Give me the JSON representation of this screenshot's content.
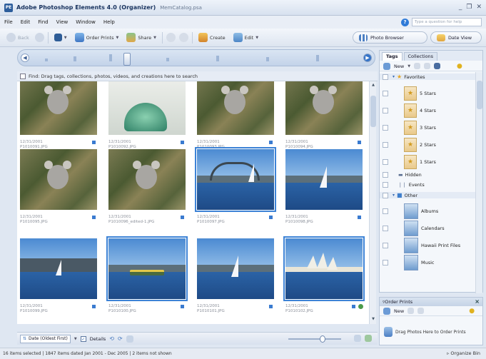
{
  "window": {
    "app_title": "Adobe Photoshop Elements 4.0 (Organizer)",
    "file_name": "MemCatalog.psa",
    "logo_text": "PE",
    "controls": [
      "_",
      "❐",
      "✕"
    ]
  },
  "menu": {
    "items": [
      "File",
      "Edit",
      "Find",
      "View",
      "Window",
      "Help"
    ],
    "help_placeholder": "Type a question for help"
  },
  "toolbar": {
    "back_label": "Back",
    "order_prints_label": "Order Prints",
    "share_label": "Share",
    "create_label": "Create",
    "edit_label": "Edit",
    "photo_browser_label": "Photo Browser",
    "date_view_label": "Date View"
  },
  "find_bar": {
    "text": "Find: Drag tags, collections, photos, videos, and creations here to search"
  },
  "photos": [
    {
      "date": "12/31/2001",
      "file": "P1010091.JPG",
      "scene": "koala",
      "selected": false
    },
    {
      "date": "12/31/2001",
      "file": "P1010092.JPG",
      "scene": "glass",
      "selected": false
    },
    {
      "date": "12/31/2001",
      "file": "P1010093.JPG",
      "scene": "koala",
      "selected": false
    },
    {
      "date": "12/31/2001",
      "file": "P1010094.JPG",
      "scene": "koala",
      "selected": false
    },
    {
      "date": "12/31/2001",
      "file": "P1010095.JPG",
      "scene": "koala",
      "selected": false
    },
    {
      "date": "12/31/2001",
      "file": "P1010096_edited-1.JPG",
      "scene": "koala",
      "selected": false
    },
    {
      "date": "12/31/2001",
      "file": "P1010097.JPG",
      "scene": "bridge",
      "selected": true
    },
    {
      "date": "12/31/2001",
      "file": "P1010098.JPG",
      "scene": "sail",
      "selected": false
    },
    {
      "date": "12/31/2001",
      "file": "P1010099.JPG",
      "scene": "sail-city",
      "selected": false
    },
    {
      "date": "12/31/2001",
      "file": "P1010100.JPG",
      "scene": "ferry",
      "selected": true
    },
    {
      "date": "12/31/2001",
      "file": "P1010101.JPG",
      "scene": "sail",
      "selected": false
    },
    {
      "date": "12/31/2001",
      "file": "P1010102.JPG",
      "scene": "opera",
      "selected": true
    }
  ],
  "bottom": {
    "sort_label": "Date (Oldest First)",
    "details_label": "Details"
  },
  "status": {
    "text": "16 items selected  |  1847 items dated Jan 2001 - Dec 2005  |  2 items not shown",
    "organize_bin": "Organize Bin"
  },
  "tags_panel": {
    "tabs": [
      "Tags",
      "Collections"
    ],
    "new_label": "New",
    "items": [
      {
        "label": "Favorites",
        "kind": "category"
      },
      {
        "label": "5 Stars",
        "kind": "star"
      },
      {
        "label": "4 Stars",
        "kind": "star"
      },
      {
        "label": "3 Stars",
        "kind": "star"
      },
      {
        "label": "2 Stars",
        "kind": "star"
      },
      {
        "label": "1 Stars",
        "kind": "star"
      },
      {
        "label": "Hidden",
        "kind": "sub"
      },
      {
        "label": "Events",
        "kind": "sub"
      },
      {
        "label": "Other",
        "kind": "category"
      },
      {
        "label": "Albums",
        "kind": "tag"
      },
      {
        "label": "Calendars",
        "kind": "tag"
      },
      {
        "label": "Hawaii Print Files",
        "kind": "tag"
      },
      {
        "label": "Music",
        "kind": "tag"
      }
    ]
  },
  "order_prints": {
    "title": "Order Prints",
    "new_label": "New",
    "drop_text": "Drag Photos Here to Order Prints"
  },
  "colors": {
    "accent": "#3d83d6",
    "panel": "#f4f7fb"
  }
}
